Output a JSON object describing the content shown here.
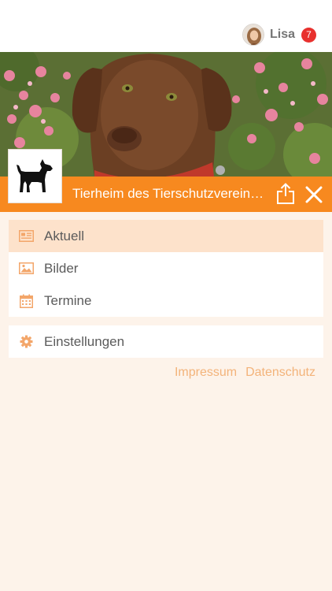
{
  "header": {
    "user_name": "Lisa",
    "notification_count": "7"
  },
  "shelter": {
    "title": "Tierheim des Tierschutzvereins Gießen"
  },
  "menu": {
    "items": [
      {
        "label": "Aktuell",
        "icon": "newspaper-icon",
        "active": true
      },
      {
        "label": "Bilder",
        "icon": "image-icon",
        "active": false
      },
      {
        "label": "Termine",
        "icon": "calendar-icon",
        "active": false
      }
    ],
    "settings_label": "Einstellungen"
  },
  "footer": {
    "impressum": "Impressum",
    "datenschutz": "Datenschutz"
  },
  "colors": {
    "accent": "#f7891f",
    "active_row": "#fde2cb",
    "background": "#fdf3ea",
    "badge": "#e8312e",
    "footer_link": "#f3b37a"
  }
}
